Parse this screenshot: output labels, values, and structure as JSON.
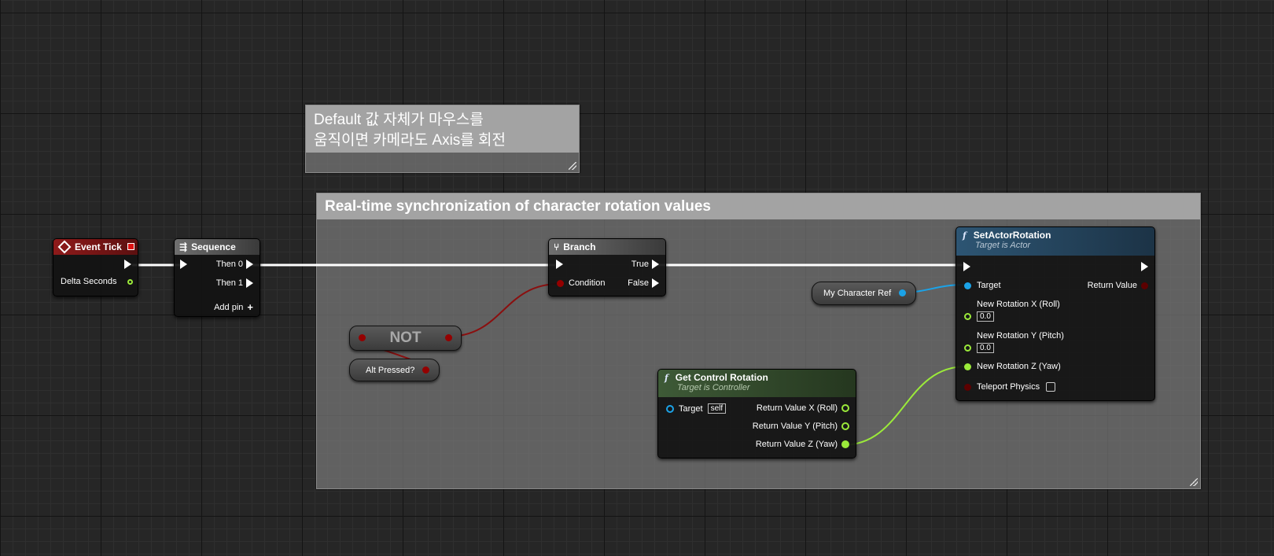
{
  "comments": {
    "note": {
      "line1": "Default 값 자체가 마우스를",
      "line2": "움직이면 카메라도 Axis를 회전"
    },
    "group": {
      "title": "Real-time synchronization of character rotation values"
    }
  },
  "nodes": {
    "event_tick": {
      "title": "Event Tick",
      "pin_delta": "Delta Seconds",
      "header_color": "#8e1a1a"
    },
    "sequence": {
      "title": "Sequence",
      "then0": "Then 0",
      "then1": "Then 1",
      "add_pin": "Add pin",
      "add_symbol": "+"
    },
    "branch": {
      "title": "Branch",
      "true_label": "True",
      "condition": "Condition",
      "false_label": "False"
    },
    "not": {
      "label": "NOT"
    },
    "alt_pressed": {
      "label": "Alt Pressed?"
    },
    "my_character_ref": {
      "label": "My Character Ref"
    },
    "set_actor_rotation": {
      "icon": "f",
      "title": "SetActorRotation",
      "subtitle": "Target is Actor",
      "target": "Target",
      "return_value": "Return Value",
      "rot_x": "New Rotation X (Roll)",
      "rot_x_value": "0.0",
      "rot_y": "New Rotation Y (Pitch)",
      "rot_y_value": "0.0",
      "rot_z": "New Rotation Z (Yaw)",
      "teleport": "Teleport Physics",
      "header_color": "#2d5573"
    },
    "get_control_rotation": {
      "icon": "f",
      "title": "Get Control Rotation",
      "subtitle": "Target is Controller",
      "target": "Target",
      "target_value": "self",
      "ret_x": "Return Value X (Roll)",
      "ret_y": "Return Value Y (Pitch)",
      "ret_z": "Return Value Z (Yaw)",
      "header_color": "#3e5a37"
    }
  },
  "colors": {
    "exec": "#ffffff",
    "bool": "#940000",
    "float": "#9bea3a",
    "object": "#1ba3e8"
  }
}
